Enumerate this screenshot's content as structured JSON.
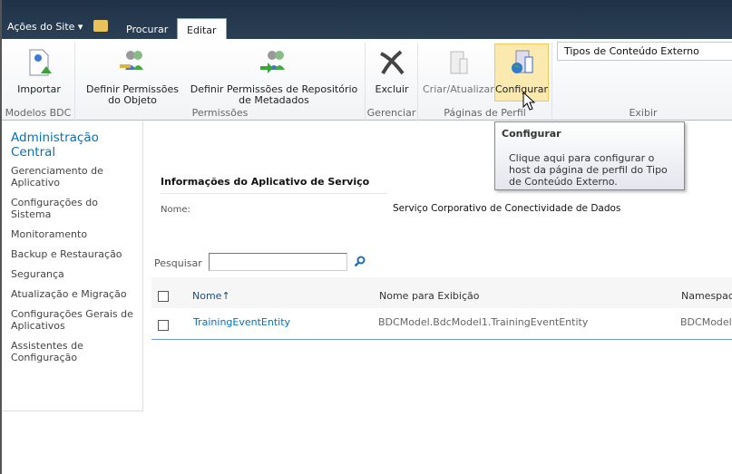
{
  "topbar": {
    "site_actions": "Ações do Site ▾",
    "tabs": [
      {
        "label": "Procurar"
      },
      {
        "label": "Editar",
        "active": true
      }
    ]
  },
  "ribbon": {
    "groups": [
      {
        "label": "Modelos BDC",
        "buttons": [
          {
            "label": "Importar",
            "icon": "import-icon"
          }
        ]
      },
      {
        "label": "Permissões",
        "buttons": [
          {
            "label": "Definir Permissões do Objeto",
            "icon": "key-users-icon"
          },
          {
            "label": "Definir Permissões de Repositório de Metadados",
            "icon": "users-arrow-icon"
          }
        ]
      },
      {
        "label": "Gerenciar",
        "buttons": [
          {
            "label": "Excluir",
            "icon": "delete-icon"
          }
        ]
      },
      {
        "label": "Páginas de Perfil",
        "buttons": [
          {
            "label": "Criar/Atualizar",
            "icon": "create-page-icon",
            "disabled": true
          },
          {
            "label": "Configurar",
            "icon": "configure-globe-icon",
            "hovered": true
          }
        ]
      },
      {
        "label": "Exibir",
        "select_value": "Tipos de Conteúdo Externo"
      }
    ]
  },
  "tooltip": {
    "title": "Configurar",
    "body": "Clique aqui para configurar o host da página de perfil do Tipo de Conteúdo Externo."
  },
  "sidebar": {
    "heading": "Administração Central",
    "items": [
      "Gerenciamento de Aplicativo",
      "Configurações do Sistema",
      "Monitoramento",
      "Backup e Restauração",
      "Segurança",
      "Atualização e Migração",
      "Configurações Gerais de Aplicativos",
      "Assistentes de Configuração"
    ]
  },
  "main": {
    "section_title": "Informações do Aplicativo de Serviço",
    "name_label": "Nome:",
    "name_value": "Serviço Corporativo de Conectividade de Dados",
    "search_label": "Pesquisar",
    "search_value": "",
    "columns": [
      "Nome↑",
      "Nome para Exibição",
      "Namespace"
    ],
    "rows": [
      {
        "name": "TrainingEventEntity",
        "display": "BDCModel.BdcModel1.TrainingEventEntity",
        "namespace": "BDCModel"
      }
    ]
  },
  "colors": {
    "accent": "#0072bc",
    "topbar": "#243a52",
    "hover": "#fbeab0"
  }
}
